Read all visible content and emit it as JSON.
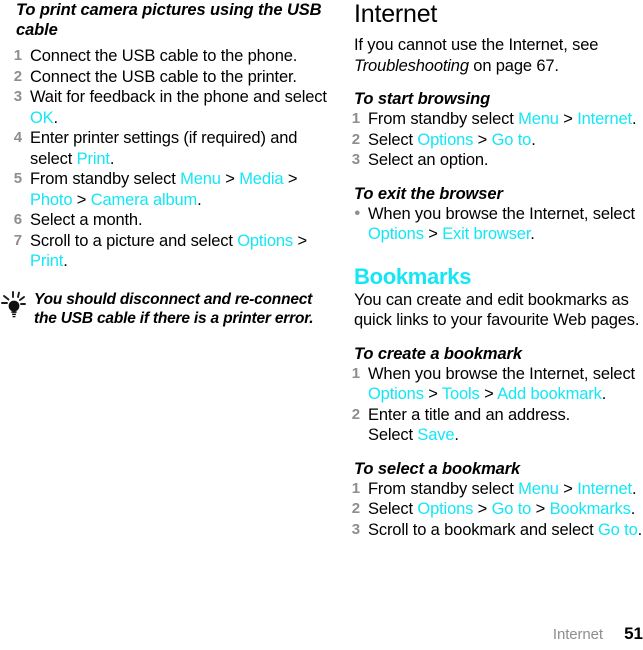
{
  "footer": {
    "chapter": "Internet",
    "page_number": "51"
  },
  "left_column": {
    "procedure": {
      "heading": "To print camera pictures using the USB cable",
      "steps": [
        {
          "number": "1",
          "parts": [
            {
              "t": "Connect the USB cable to the phone.",
              "s": "plain"
            }
          ]
        },
        {
          "number": "2",
          "parts": [
            {
              "t": "Connect the USB cable to the printer.",
              "s": "plain"
            }
          ]
        },
        {
          "number": "3",
          "parts": [
            {
              "t": "Wait for feedback in the phone and select ",
              "s": "plain"
            },
            {
              "t": "OK",
              "s": "ui"
            },
            {
              "t": ".",
              "s": "plain"
            }
          ]
        },
        {
          "number": "4",
          "parts": [
            {
              "t": "Enter printer settings (if required) and select ",
              "s": "plain"
            },
            {
              "t": "Print",
              "s": "ui"
            },
            {
              "t": ".",
              "s": "plain"
            }
          ]
        },
        {
          "number": "5",
          "parts": [
            {
              "t": "From standby select ",
              "s": "plain"
            },
            {
              "t": "Menu",
              "s": "ui"
            },
            {
              "t": " > ",
              "s": "sep"
            },
            {
              "t": "Media",
              "s": "ui"
            },
            {
              "t": " > ",
              "s": "sep"
            },
            {
              "t": "Photo",
              "s": "ui"
            },
            {
              "t": " > ",
              "s": "sep"
            },
            {
              "t": "Camera album",
              "s": "ui"
            },
            {
              "t": ".",
              "s": "plain"
            }
          ]
        },
        {
          "number": "6",
          "parts": [
            {
              "t": "Select a month.",
              "s": "plain"
            }
          ]
        },
        {
          "number": "7",
          "parts": [
            {
              "t": "Scroll to a picture and select ",
              "s": "plain"
            },
            {
              "t": "Options",
              "s": "ui"
            },
            {
              "t": " > ",
              "s": "sep"
            },
            {
              "t": "Print",
              "s": "ui"
            },
            {
              "t": ".",
              "s": "plain"
            }
          ]
        }
      ]
    },
    "tip": {
      "icon": "lightbulb-icon",
      "text": "You should disconnect and re-connect the USB cable if there is a printer error."
    }
  },
  "right_column": {
    "title": "Internet",
    "intro": [
      {
        "t": "If you cannot use the Internet, see ",
        "s": "plain"
      },
      {
        "t": "Troubleshooting",
        "s": "ital"
      },
      {
        "t": " on page 67.",
        "s": "plain"
      }
    ],
    "sections": [
      {
        "heading": "To start browsing",
        "heading_style": "procedure",
        "list_type": "ordered",
        "steps": [
          {
            "number": "1",
            "parts": [
              {
                "t": "From standby select ",
                "s": "plain"
              },
              {
                "t": "Menu",
                "s": "ui"
              },
              {
                "t": " > ",
                "s": "sep"
              },
              {
                "t": "Internet",
                "s": "ui"
              },
              {
                "t": ".",
                "s": "plain"
              }
            ]
          },
          {
            "number": "2",
            "parts": [
              {
                "t": "Select ",
                "s": "plain"
              },
              {
                "t": "Options",
                "s": "ui"
              },
              {
                "t": " > ",
                "s": "sep"
              },
              {
                "t": "Go to",
                "s": "ui"
              },
              {
                "t": ".",
                "s": "plain"
              }
            ]
          },
          {
            "number": "3",
            "parts": [
              {
                "t": "Select an option.",
                "s": "plain"
              }
            ]
          }
        ]
      },
      {
        "heading": "To exit the browser",
        "heading_style": "procedure",
        "list_type": "bulleted",
        "steps": [
          {
            "number": "•",
            "parts": [
              {
                "t": "When you browse the Internet, select ",
                "s": "plain"
              },
              {
                "t": "Options",
                "s": "ui"
              },
              {
                "t": " > ",
                "s": "sep"
              },
              {
                "t": "Exit browser",
                "s": "ui"
              },
              {
                "t": ".",
                "s": "plain"
              }
            ]
          }
        ]
      },
      {
        "heading": "Bookmarks",
        "heading_style": "section",
        "body": "You can create and edit bookmarks as quick links to your favourite Web pages."
      },
      {
        "heading": "To create a bookmark",
        "heading_style": "procedure",
        "list_type": "ordered",
        "steps": [
          {
            "number": "1",
            "parts": [
              {
                "t": "When you browse the Internet, select ",
                "s": "plain"
              },
              {
                "t": "Options",
                "s": "ui"
              },
              {
                "t": " > ",
                "s": "sep"
              },
              {
                "t": "Tools",
                "s": "ui"
              },
              {
                "t": " > ",
                "s": "sep"
              },
              {
                "t": "Add bookmark",
                "s": "ui"
              },
              {
                "t": ".",
                "s": "plain"
              }
            ]
          },
          {
            "number": "2",
            "parts": [
              {
                "t": "Enter a title and an address.",
                "s": "plain"
              },
              {
                "t": "\n",
                "s": "br"
              },
              {
                "t": "Select ",
                "s": "plain"
              },
              {
                "t": "Save",
                "s": "ui"
              },
              {
                "t": ".",
                "s": "plain"
              }
            ]
          }
        ]
      },
      {
        "heading": "To select a bookmark",
        "heading_style": "procedure",
        "list_type": "ordered",
        "steps": [
          {
            "number": "1",
            "parts": [
              {
                "t": "From standby select ",
                "s": "plain"
              },
              {
                "t": "Menu",
                "s": "ui"
              },
              {
                "t": " > ",
                "s": "sep"
              },
              {
                "t": "Internet",
                "s": "ui"
              },
              {
                "t": ".",
                "s": "plain"
              }
            ]
          },
          {
            "number": "2",
            "parts": [
              {
                "t": "Select ",
                "s": "plain"
              },
              {
                "t": "Options",
                "s": "ui"
              },
              {
                "t": " > ",
                "s": "sep"
              },
              {
                "t": "Go to",
                "s": "ui"
              },
              {
                "t": " > ",
                "s": "sep"
              },
              {
                "t": "Bookmarks",
                "s": "ui"
              },
              {
                "t": ".",
                "s": "plain"
              }
            ]
          },
          {
            "number": "3",
            "parts": [
              {
                "t": "Scroll to a bookmark and select ",
                "s": "plain"
              },
              {
                "t": "Go to",
                "s": "ui"
              },
              {
                "t": ".",
                "s": "plain"
              }
            ]
          }
        ]
      }
    ]
  },
  "colors": {
    "ui_term": "#14E6F5",
    "marker_gray": "#8E8E8E",
    "body_black": "#000000"
  }
}
